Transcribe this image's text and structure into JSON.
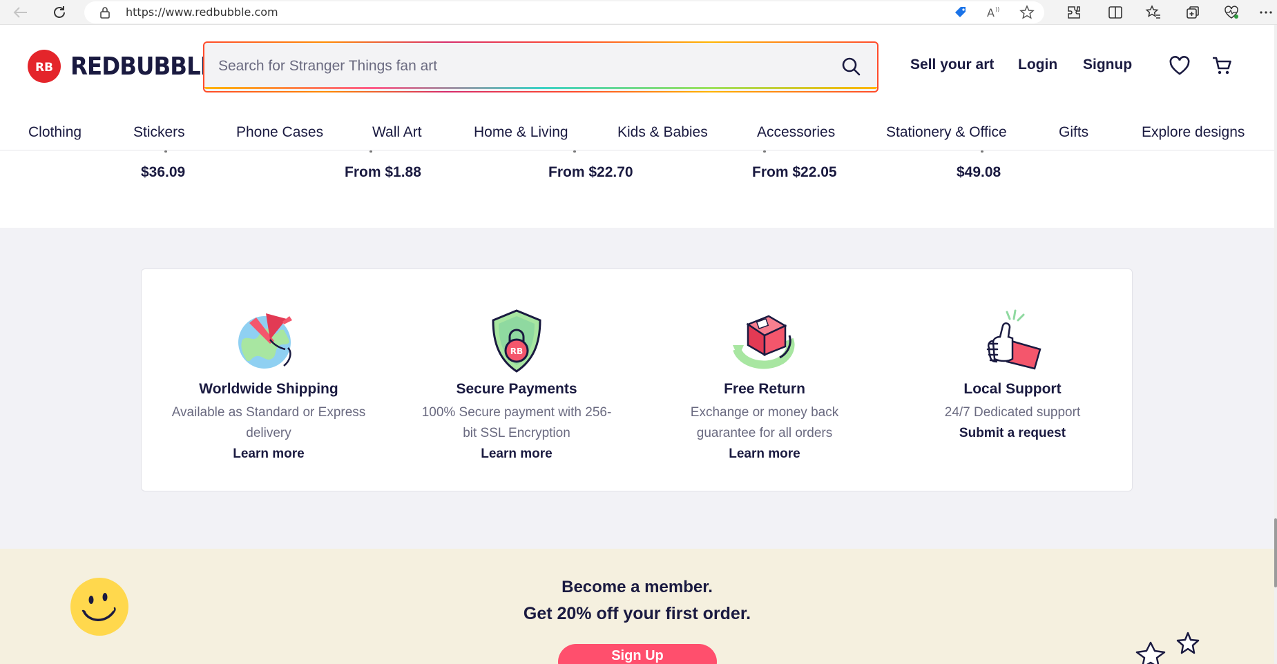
{
  "browser": {
    "url": "https://www.redbubble.com",
    "icons": [
      "back-arrow-icon",
      "refresh-icon",
      "lock-icon",
      "price-tag-icon",
      "read-aloud-icon",
      "star-icon",
      "extensions-icon",
      "split-screen-icon",
      "favorites-icon",
      "collections-icon",
      "health-icon",
      "more-icon"
    ]
  },
  "header": {
    "logo_text": "REDBUBBLE",
    "search_placeholder": "Search for Stranger Things fan art",
    "sell_label": "Sell your art",
    "login_label": "Login",
    "signup_label": "Signup"
  },
  "categories": [
    "Clothing",
    "Stickers",
    "Phone Cases",
    "Wall Art",
    "Home & Living",
    "Kids & Babies",
    "Accessories",
    "Stationery & Office",
    "Gifts",
    "Explore designs"
  ],
  "products": {
    "prices": [
      "$36.09",
      "From $1.88",
      "From $22.70",
      "From $22.05",
      "$49.08"
    ]
  },
  "value_props": [
    {
      "title": "Worldwide Shipping",
      "desc_line1": "Available as Standard or Express",
      "desc_line2": "delivery",
      "link": "Learn more"
    },
    {
      "title": "Secure Payments",
      "desc_line1": "100% Secure payment with 256-",
      "desc_line2": "bit SSL Encryption",
      "link": "Learn more"
    },
    {
      "title": "Free Return",
      "desc_line1": "Exchange or money back",
      "desc_line2": "guarantee for all orders",
      "link": "Learn more"
    },
    {
      "title": "Local Support",
      "desc_line1": "24/7 Dedicated support",
      "link": "Submit a request"
    }
  ],
  "membership": {
    "line1": "Become a member.",
    "line2": "Get 20% off your first order.",
    "button": "Sign Up"
  },
  "colors": {
    "brand_red": "#e4252b",
    "text_navy": "#1a1a40",
    "signup_pink": "#ff4f6d",
    "member_bg": "#f5f0df"
  }
}
